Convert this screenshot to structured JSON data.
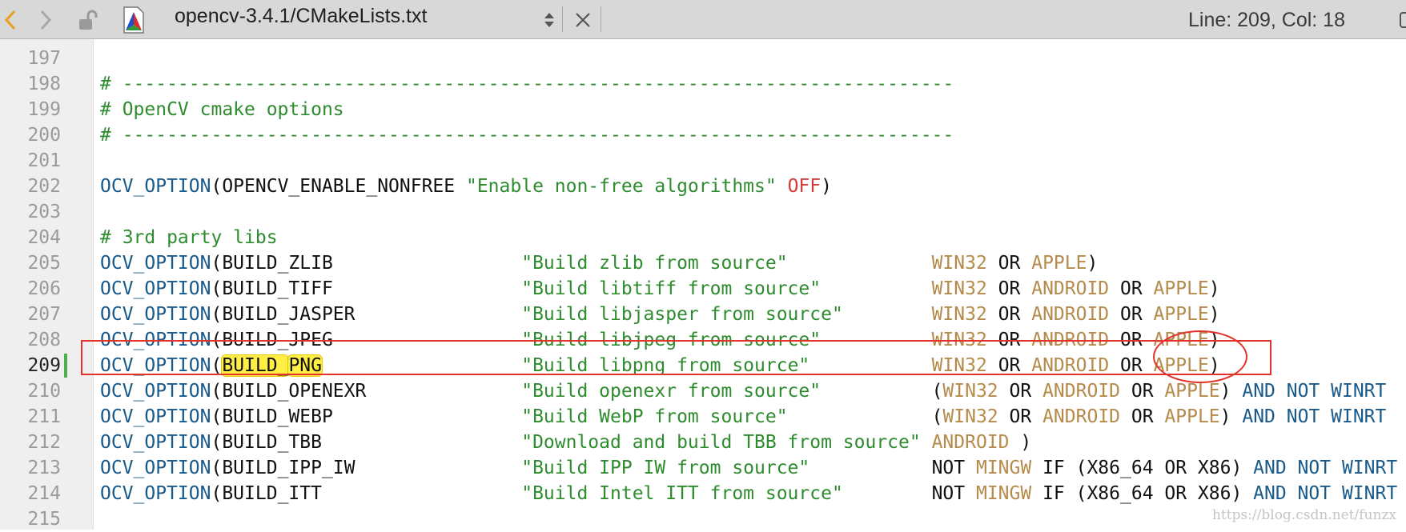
{
  "toolbar": {
    "file_title": "opencv-3.4.1/CMakeLists.txt",
    "status": "Line: 209, Col: 18"
  },
  "colors": {
    "comment": "#2e8b2e",
    "function": "#1a5a8a",
    "string": "#2e8b2e",
    "constant": "#b58a4a",
    "off": "#d43c3c",
    "annotation": "#e4322b",
    "highlight": "#ffee44"
  },
  "editor": {
    "current_line": 209,
    "lines": [
      {
        "num": "197",
        "tokens": []
      },
      {
        "num": "198",
        "tokens": [
          {
            "t": "# ---------------------------------------------------------------------------",
            "k": "comment"
          }
        ]
      },
      {
        "num": "199",
        "tokens": [
          {
            "t": "# OpenCV cmake options",
            "k": "comment"
          }
        ]
      },
      {
        "num": "200",
        "tokens": [
          {
            "t": "# ---------------------------------------------------------------------------",
            "k": "comment"
          }
        ]
      },
      {
        "num": "201",
        "tokens": []
      },
      {
        "num": "202",
        "tokens": [
          {
            "t": "OCV_OPTION",
            "k": "fn"
          },
          {
            "t": "(OPENCV_ENABLE_NONFREE ",
            "k": "plain"
          },
          {
            "t": "\"Enable non-free algorithms\"",
            "k": "str"
          },
          {
            "t": " ",
            "k": "plain"
          },
          {
            "t": "OFF",
            "k": "off"
          },
          {
            "t": ")",
            "k": "plain"
          }
        ]
      },
      {
        "num": "203",
        "tokens": []
      },
      {
        "num": "204",
        "tokens": [
          {
            "t": "# 3rd party libs",
            "k": "comment"
          }
        ]
      },
      {
        "num": "205",
        "tokens": [
          {
            "t": "OCV_OPTION",
            "k": "fn"
          },
          {
            "t": "(BUILD_ZLIB                 ",
            "k": "plain"
          },
          {
            "t": "\"Build zlib from source\"",
            "k": "str"
          },
          {
            "t": "             ",
            "k": "plain"
          },
          {
            "t": "WIN32",
            "k": "const"
          },
          {
            "t": " OR ",
            "k": "plain"
          },
          {
            "t": "APPLE",
            "k": "const"
          },
          {
            "t": ")",
            "k": "plain"
          }
        ]
      },
      {
        "num": "206",
        "tokens": [
          {
            "t": "OCV_OPTION",
            "k": "fn"
          },
          {
            "t": "(BUILD_TIFF                 ",
            "k": "plain"
          },
          {
            "t": "\"Build libtiff from source\"",
            "k": "str"
          },
          {
            "t": "          ",
            "k": "plain"
          },
          {
            "t": "WIN32",
            "k": "const"
          },
          {
            "t": " OR ",
            "k": "plain"
          },
          {
            "t": "ANDROID",
            "k": "const"
          },
          {
            "t": " OR ",
            "k": "plain"
          },
          {
            "t": "APPLE",
            "k": "const"
          },
          {
            "t": ")",
            "k": "plain"
          }
        ]
      },
      {
        "num": "207",
        "tokens": [
          {
            "t": "OCV_OPTION",
            "k": "fn"
          },
          {
            "t": "(BUILD_JASPER               ",
            "k": "plain"
          },
          {
            "t": "\"Build libjasper from source\"",
            "k": "str"
          },
          {
            "t": "        ",
            "k": "plain"
          },
          {
            "t": "WIN32",
            "k": "const"
          },
          {
            "t": " OR ",
            "k": "plain"
          },
          {
            "t": "ANDROID",
            "k": "const"
          },
          {
            "t": " OR ",
            "k": "plain"
          },
          {
            "t": "APPLE",
            "k": "const"
          },
          {
            "t": ")",
            "k": "plain"
          }
        ]
      },
      {
        "num": "208",
        "tokens": [
          {
            "t": "OCV_OPTION",
            "k": "fn"
          },
          {
            "t": "(BUILD_JPEG                 ",
            "k": "plain"
          },
          {
            "t": "\"Build libjpeg from source\"",
            "k": "str"
          },
          {
            "t": "          ",
            "k": "plain"
          },
          {
            "t": "WIN32",
            "k": "const"
          },
          {
            "t": " OR ",
            "k": "plain"
          },
          {
            "t": "ANDROID",
            "k": "const"
          },
          {
            "t": " OR ",
            "k": "plain"
          },
          {
            "t": "APPLE",
            "k": "const"
          },
          {
            "t": ")",
            "k": "plain"
          }
        ]
      },
      {
        "num": "209",
        "tokens": [
          {
            "t": "OCV_OPTION",
            "k": "fn"
          },
          {
            "t": "(",
            "k": "plain"
          },
          {
            "t": "BUILD_",
            "k": "hl"
          },
          {
            "t": "",
            "k": "cursor"
          },
          {
            "t": "PNG",
            "k": "hl"
          },
          {
            "t": "                  ",
            "k": "plain"
          },
          {
            "t": "\"Build libpng from source\"",
            "k": "str"
          },
          {
            "t": "           ",
            "k": "plain"
          },
          {
            "t": "WIN32",
            "k": "const"
          },
          {
            "t": " OR ",
            "k": "plain"
          },
          {
            "t": "ANDROID",
            "k": "const"
          },
          {
            "t": " OR ",
            "k": "plain"
          },
          {
            "t": "APPLE",
            "k": "const"
          },
          {
            "t": ")",
            "k": "plain"
          }
        ]
      },
      {
        "num": "210",
        "tokens": [
          {
            "t": "OCV_OPTION",
            "k": "fn"
          },
          {
            "t": "(BUILD_OPENEXR              ",
            "k": "plain"
          },
          {
            "t": "\"Build openexr from source\"",
            "k": "str"
          },
          {
            "t": "          (",
            "k": "plain"
          },
          {
            "t": "WIN32",
            "k": "const"
          },
          {
            "t": " OR ",
            "k": "plain"
          },
          {
            "t": "ANDROID",
            "k": "const"
          },
          {
            "t": " OR ",
            "k": "plain"
          },
          {
            "t": "APPLE",
            "k": "const"
          },
          {
            "t": ") ",
            "k": "plain"
          },
          {
            "t": "AND NOT WINRT",
            "k": "fn"
          }
        ]
      },
      {
        "num": "211",
        "tokens": [
          {
            "t": "OCV_OPTION",
            "k": "fn"
          },
          {
            "t": "(BUILD_WEBP                 ",
            "k": "plain"
          },
          {
            "t": "\"Build WebP from source\"",
            "k": "str"
          },
          {
            "t": "             (",
            "k": "plain"
          },
          {
            "t": "WIN32",
            "k": "const"
          },
          {
            "t": " OR ",
            "k": "plain"
          },
          {
            "t": "ANDROID",
            "k": "const"
          },
          {
            "t": " OR ",
            "k": "plain"
          },
          {
            "t": "APPLE",
            "k": "const"
          },
          {
            "t": ") ",
            "k": "plain"
          },
          {
            "t": "AND NOT WINRT",
            "k": "fn"
          }
        ]
      },
      {
        "num": "212",
        "tokens": [
          {
            "t": "OCV_OPTION",
            "k": "fn"
          },
          {
            "t": "(BUILD_TBB                  ",
            "k": "plain"
          },
          {
            "t": "\"Download and build TBB from source\"",
            "k": "str"
          },
          {
            "t": " ",
            "k": "plain"
          },
          {
            "t": "ANDROID",
            "k": "const"
          },
          {
            "t": " )",
            "k": "plain"
          }
        ]
      },
      {
        "num": "213",
        "tokens": [
          {
            "t": "OCV_OPTION",
            "k": "fn"
          },
          {
            "t": "(BUILD_IPP_IW               ",
            "k": "plain"
          },
          {
            "t": "\"Build IPP IW from source\"",
            "k": "str"
          },
          {
            "t": "           NOT ",
            "k": "plain"
          },
          {
            "t": "MINGW",
            "k": "const"
          },
          {
            "t": " IF (X86_64 OR X86) ",
            "k": "plain"
          },
          {
            "t": "AND NOT WINRT",
            "k": "fn"
          }
        ]
      },
      {
        "num": "214",
        "tokens": [
          {
            "t": "OCV_OPTION",
            "k": "fn"
          },
          {
            "t": "(BUILD_ITT                  ",
            "k": "plain"
          },
          {
            "t": "\"Build Intel ITT from source\"",
            "k": "str"
          },
          {
            "t": "        NOT ",
            "k": "plain"
          },
          {
            "t": "MINGW",
            "k": "const"
          },
          {
            "t": " IF (X86_64 OR X86) ",
            "k": "plain"
          },
          {
            "t": "AND NOT WINRT",
            "k": "fn"
          }
        ]
      },
      {
        "num": "215",
        "tokens": []
      }
    ]
  },
  "watermark": "https://blog.csdn.net/funzx"
}
